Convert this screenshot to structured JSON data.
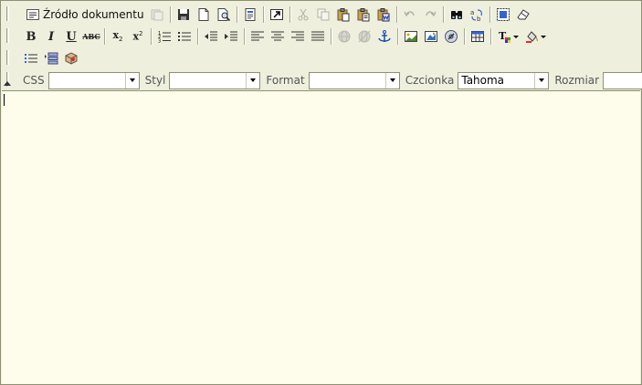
{
  "toolbar": {
    "source_label": "Źródło dokumentu",
    "row1_buttons": [
      {
        "name": "source-icon"
      },
      {
        "name": "templates-icon",
        "disabled": true
      },
      {
        "name": "save-icon"
      },
      {
        "name": "new-page-icon"
      },
      {
        "name": "preview-icon"
      },
      {
        "name": "templates-doc-icon"
      },
      {
        "name": "maximize-icon"
      },
      {
        "name": "cut-icon",
        "disabled": true
      },
      {
        "name": "copy-icon",
        "disabled": true
      },
      {
        "name": "paste-icon"
      },
      {
        "name": "paste-text-icon"
      },
      {
        "name": "paste-word-icon"
      },
      {
        "name": "undo-icon",
        "disabled": true
      },
      {
        "name": "redo-icon",
        "disabled": true
      },
      {
        "name": "find-icon"
      },
      {
        "name": "replace-icon"
      },
      {
        "name": "select-all-icon"
      },
      {
        "name": "remove-format-icon"
      }
    ],
    "format": {
      "bold": "B",
      "italic": "I",
      "underline": "U",
      "strike": "ABC",
      "subscript_base": "x",
      "subscript_mark": "2",
      "superscript_base": "x",
      "superscript_mark": "2",
      "text_color_letter": "T"
    }
  },
  "combos": [
    {
      "label": "CSS",
      "value": ""
    },
    {
      "label": "Styl",
      "value": ""
    },
    {
      "label": "Format",
      "value": ""
    },
    {
      "label": "Czcionka",
      "value": "Tahoma"
    },
    {
      "label": "Rozmiar",
      "value": ""
    }
  ],
  "colors": {
    "toolbar_bg": "#efefde",
    "content_bg": "#fefcea",
    "border": "#8f8f73"
  }
}
